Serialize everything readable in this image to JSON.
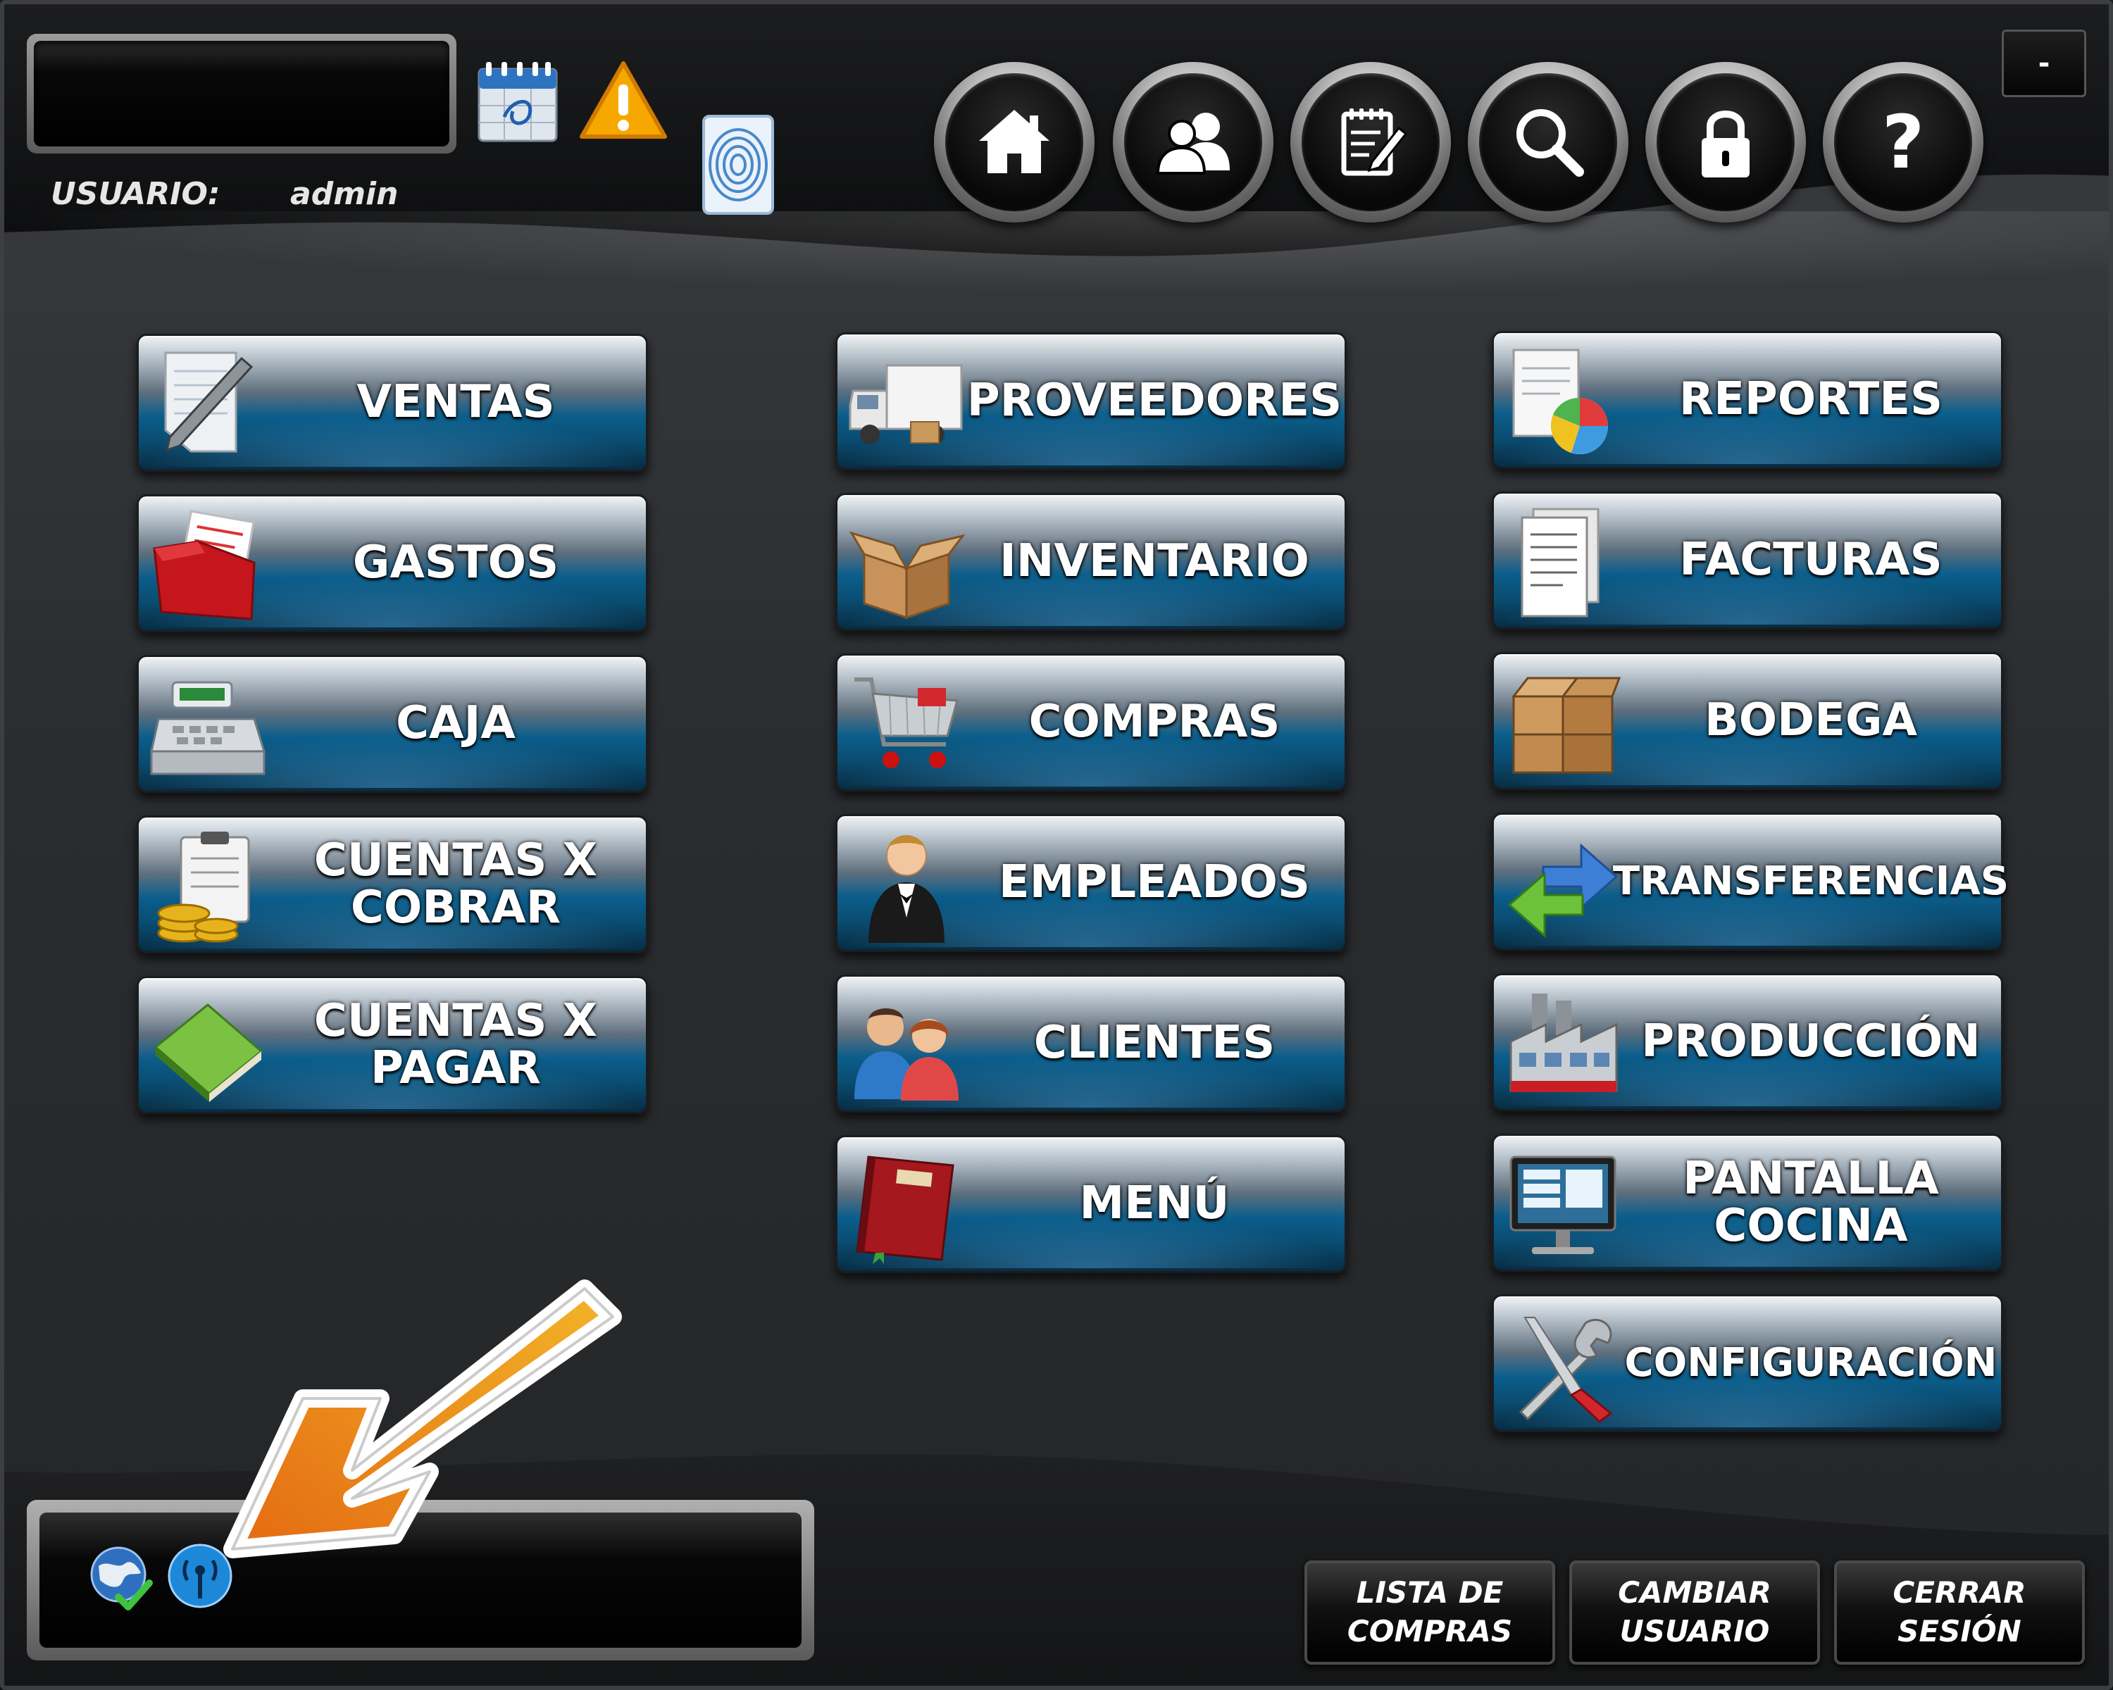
{
  "header": {
    "user_label": "USUARIO:",
    "user_name": "admin",
    "minimize_label": "-",
    "icons": [
      "calendar-icon",
      "warning-icon",
      "fingerprint-icon"
    ]
  },
  "nav": [
    {
      "name": "home",
      "icon": "home-icon"
    },
    {
      "name": "users",
      "icon": "users-icon"
    },
    {
      "name": "notes",
      "icon": "notepad-icon"
    },
    {
      "name": "search",
      "icon": "search-icon"
    },
    {
      "name": "lock",
      "icon": "lock-icon"
    },
    {
      "name": "help",
      "icon": "help-icon",
      "glyph": "?"
    }
  ],
  "tiles": {
    "ventas": "VENTAS",
    "gastos": "GASTOS",
    "caja": "CAJA",
    "cuentas_cobrar": "CUENTAS X\nCOBRAR",
    "cuentas_pagar": "CUENTAS X\nPAGAR",
    "proveedores": "PROVEEDORES",
    "inventario": "INVENTARIO",
    "compras": "COMPRAS",
    "empleados": "EMPLEADOS",
    "clientes": "CLIENTES",
    "menu": "MENÚ",
    "reportes": "REPORTES",
    "facturas": "FACTURAS",
    "bodega": "BODEGA",
    "transferencias": "TRANSFERENCIAS",
    "produccion": "PRODUCCIÓN",
    "pantalla_cocina": "PANTALLA\nCOCINA",
    "configuracion": "CONFIGURACIÓN"
  },
  "footer": {
    "lista_compras": "LISTA DE\nCOMPRAS",
    "cambiar_usuario": "CAMBIAR\nUSUARIO",
    "cerrar_sesion": "CERRAR\nSESIÓN",
    "status_icons": [
      "globe-connected-icon",
      "antenna-icon"
    ]
  },
  "colors": {
    "tile_blue": "#0b5e8c",
    "annotation_orange": "#f0a020",
    "warning_yellow": "#f7a800"
  }
}
